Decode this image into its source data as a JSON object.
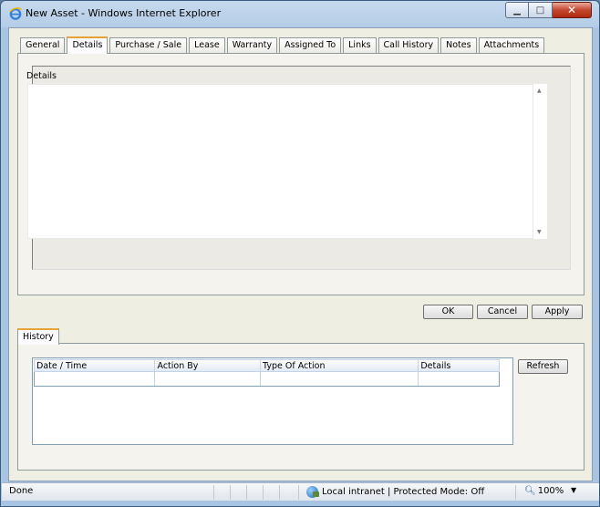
{
  "window": {
    "title": "New Asset - Windows Internet Explorer"
  },
  "tabs": [
    "General",
    "Details",
    "Purchase / Sale",
    "Lease",
    "Warranty",
    "Assigned To",
    "Links",
    "Call History",
    "Notes",
    "Attachments"
  ],
  "active_tab": "Details",
  "details": {
    "label": "Details",
    "value": ""
  },
  "buttons": {
    "ok": "OK",
    "cancel": "Cancel",
    "apply": "Apply",
    "refresh": "Refresh"
  },
  "history": {
    "tab_label": "History",
    "columns": [
      "Date / Time",
      "Action By",
      "Type Of Action",
      "Details"
    ],
    "rows": []
  },
  "statusbar": {
    "status": "Done",
    "zone": "Local intranet | Protected Mode: Off",
    "zoom": "100%"
  }
}
